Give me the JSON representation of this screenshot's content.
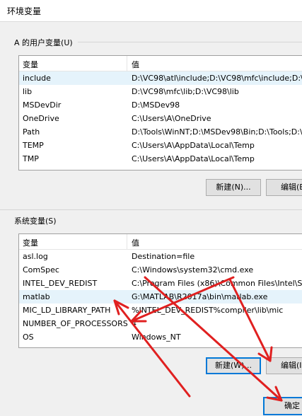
{
  "window": {
    "title": "环境变量"
  },
  "user_section": {
    "label": "A 的用户变量(U)",
    "headers": {
      "variable": "变量",
      "value": "值"
    },
    "rows": [
      {
        "name": "include",
        "value": "D:\\VC98\\atl\\include;D:\\VC98\\mfc\\include;D:\\VC"
      },
      {
        "name": "lib",
        "value": "D:\\VC98\\mfc\\lib;D:\\VC98\\lib"
      },
      {
        "name": "MSDevDir",
        "value": "D:\\MSDev98"
      },
      {
        "name": "OneDrive",
        "value": "C:\\Users\\A\\OneDrive"
      },
      {
        "name": "Path",
        "value": "D:\\Tools\\WinNT;D:\\MSDev98\\Bin;D:\\Tools;D:\\"
      },
      {
        "name": "TEMP",
        "value": "C:\\Users\\A\\AppData\\Local\\Temp"
      },
      {
        "name": "TMP",
        "value": "C:\\Users\\A\\AppData\\Local\\Temp"
      }
    ],
    "buttons": {
      "new": "新建(N)...",
      "edit": "编辑(E"
    }
  },
  "system_section": {
    "label": "系统变量(S)",
    "headers": {
      "variable": "变量",
      "value": "值"
    },
    "rows": [
      {
        "name": "asl.log",
        "value": "Destination=file"
      },
      {
        "name": "ComSpec",
        "value": "C:\\Windows\\system32\\cmd.exe"
      },
      {
        "name": "INTEL_DEV_REDIST",
        "value": "C:\\Program Files (x86)\\Common Files\\Intel\\Sh"
      },
      {
        "name": "matlab",
        "value": "G:\\MATLAB\\R2017a\\bin\\matlab.exe"
      },
      {
        "name": "MIC_LD_LIBRARY_PATH",
        "value": "%INTEL_DEV_REDIST%compiler\\lib\\mic"
      },
      {
        "name": "NUMBER_OF_PROCESSORS",
        "value": "4"
      },
      {
        "name": "OS",
        "value": "Windows_NT"
      }
    ],
    "buttons": {
      "new": "新建(W)...",
      "edit": "编辑(I"
    }
  },
  "footer": {
    "ok": "确定"
  },
  "colors": {
    "accent": "#0078d7",
    "selection": "#e5f3fb",
    "annotation": "#e02020"
  }
}
